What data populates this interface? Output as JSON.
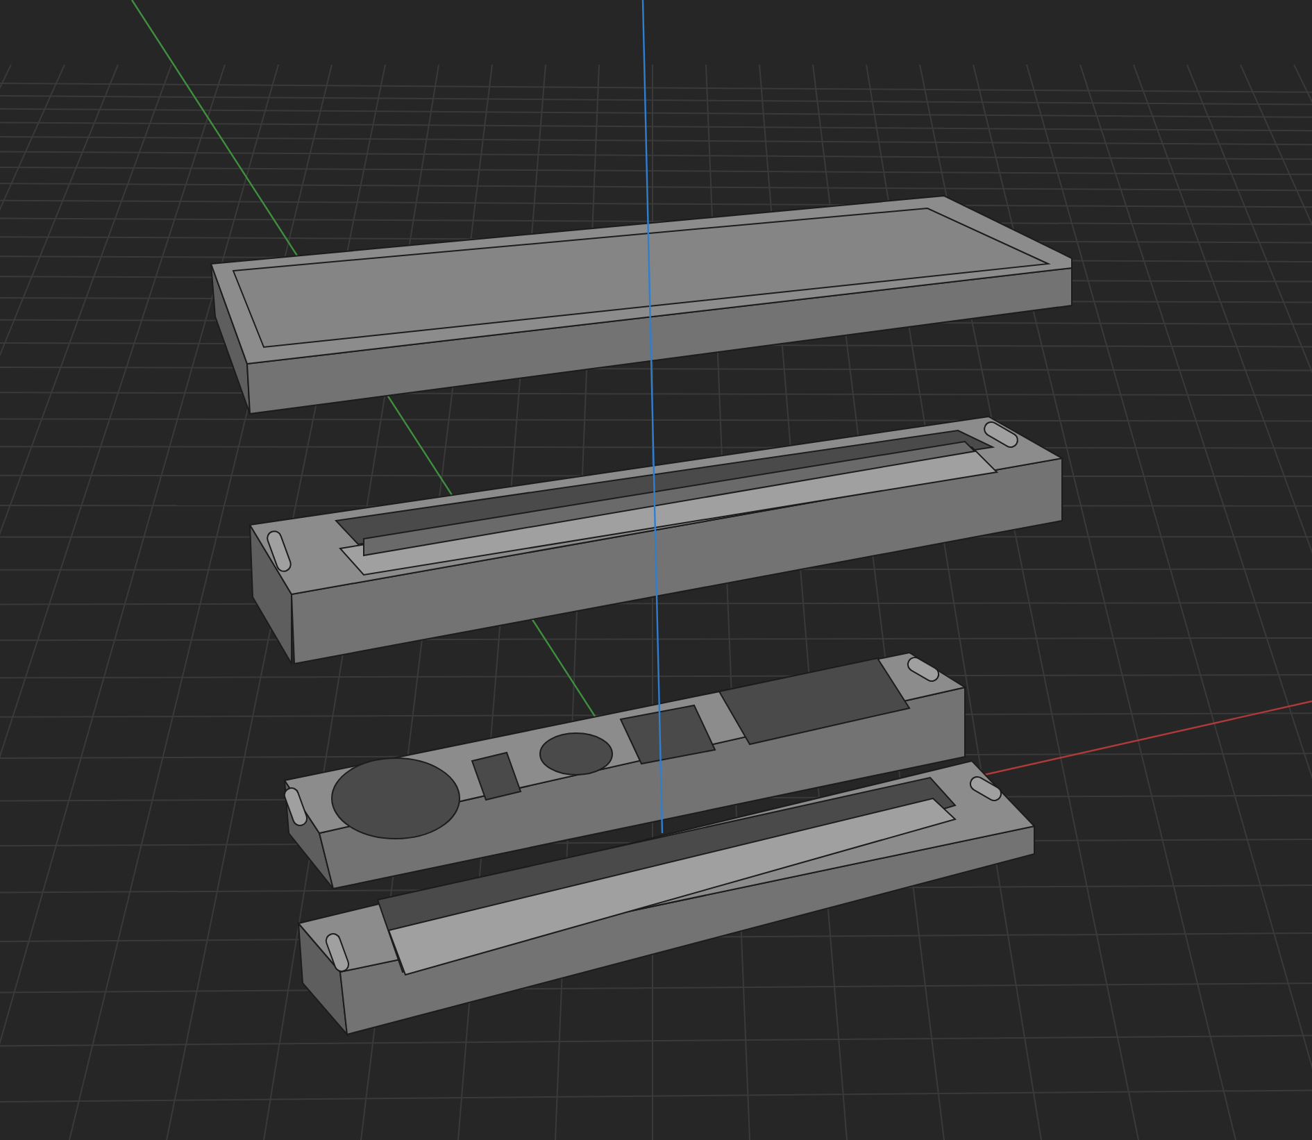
{
  "viewport": {
    "grid": true,
    "axes": true
  },
  "parts": [
    {
      "kind": "lid"
    },
    {
      "kind": "tray"
    },
    {
      "kind": "base"
    }
  ]
}
